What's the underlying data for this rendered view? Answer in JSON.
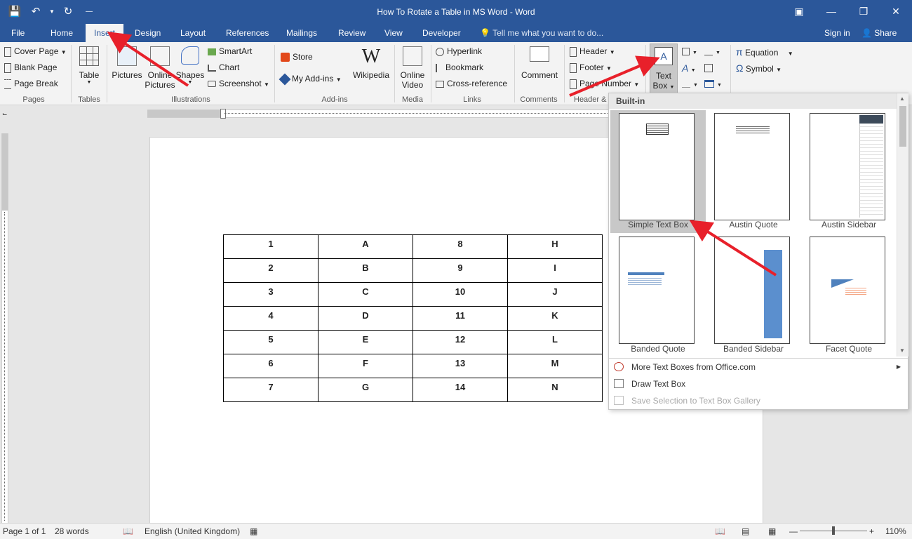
{
  "titlebar": {
    "title": "How To Rotate a Table in MS Word - Word"
  },
  "tabs": [
    "File",
    "Home",
    "Insert",
    "Design",
    "Layout",
    "References",
    "Mailings",
    "Review",
    "View",
    "Developer"
  ],
  "tell_me": "Tell me what you want to do...",
  "sign_in": "Sign in",
  "share": "Share",
  "ribbon": {
    "pages": {
      "label": "Pages",
      "cover_page": "Cover Page",
      "blank_page": "Blank Page",
      "page_break": "Page Break"
    },
    "tables": {
      "label": "Tables",
      "table": "Table"
    },
    "illustrations": {
      "label": "Illustrations",
      "pictures": "Pictures",
      "online_pictures_1": "Online",
      "online_pictures_2": "Pictures",
      "shapes": "Shapes",
      "smartart": "SmartArt",
      "chart": "Chart",
      "screenshot": "Screenshot"
    },
    "addins": {
      "label": "Add-ins",
      "store": "Store",
      "my_addins": "My Add-ins",
      "wikipedia": "Wikipedia"
    },
    "media": {
      "label": "Media",
      "online_video_1": "Online",
      "online_video_2": "Video"
    },
    "links": {
      "label": "Links",
      "hyperlink": "Hyperlink",
      "bookmark": "Bookmark",
      "cross_reference": "Cross-reference"
    },
    "comments": {
      "label": "Comments",
      "comment": "Comment"
    },
    "header_footer": {
      "label": "Header &",
      "header": "Header",
      "footer": "Footer",
      "page_number": "Page Number"
    },
    "text": {
      "text_box_1": "Text",
      "text_box_2": "Box"
    },
    "symbols": {
      "equation": "Equation",
      "symbol": "Symbol"
    }
  },
  "table": {
    "rows": [
      [
        "1",
        "A",
        "8",
        "H"
      ],
      [
        "2",
        "B",
        "9",
        "I"
      ],
      [
        "3",
        "C",
        "10",
        "J"
      ],
      [
        "4",
        "D",
        "11",
        "K"
      ],
      [
        "5",
        "E",
        "12",
        "L"
      ],
      [
        "6",
        "F",
        "13",
        "M"
      ],
      [
        "7",
        "G",
        "14",
        "N"
      ]
    ]
  },
  "gallery": {
    "header": "Built-in",
    "items": [
      "Simple Text Box",
      "Austin Quote",
      "Austin Sidebar",
      "Banded Quote",
      "Banded Sidebar",
      "Facet Quote"
    ],
    "menu": {
      "more": "More Text Boxes from Office.com",
      "draw": "Draw Text Box",
      "save": "Save Selection to Text Box Gallery"
    }
  },
  "statusbar": {
    "page": "Page 1 of 1",
    "words": "28 words",
    "language": "English (United Kingdom)",
    "zoom": "110%"
  },
  "colors": {
    "accent": "#2b579a",
    "arrow": "#e8202a"
  },
  "icons": [
    "save-icon",
    "undo-icon",
    "redo-icon",
    "lightbulb-icon",
    "person-icon",
    "store-icon",
    "wikipedia-icon"
  ]
}
